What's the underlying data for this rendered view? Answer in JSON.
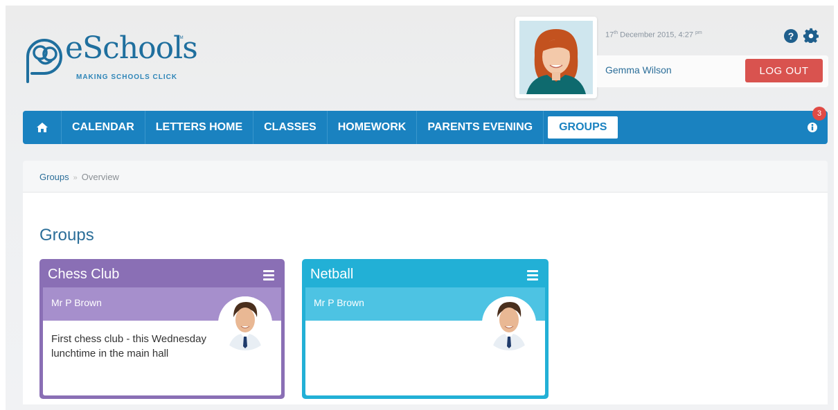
{
  "logo": {
    "wordmark": "eSchools",
    "tm": "TM",
    "tagline": "MAKING SCHOOLS CLICK"
  },
  "user": {
    "date_main": "17",
    "date_sup": "th",
    "date_rest": " December 2015, 4:27 ",
    "time_sup": "pm",
    "name": "Gemma Wilson",
    "logout_label": "LOG OUT"
  },
  "nav": {
    "items": [
      {
        "label": "CALENDAR"
      },
      {
        "label": "LETTERS HOME"
      },
      {
        "label": "CLASSES"
      },
      {
        "label": "HOMEWORK"
      },
      {
        "label": "PARENTS EVENING"
      },
      {
        "label": "GROUPS"
      }
    ],
    "notification_count": "3"
  },
  "breadcrumb": {
    "root": "Groups",
    "separator": "»",
    "current": "Overview"
  },
  "page": {
    "heading": "Groups"
  },
  "groups": [
    {
      "title": "Chess Club",
      "teacher": "Mr P Brown",
      "text": "First chess club - this Wednesday lunchtime in the main hall",
      "color": "#8a6fb5"
    },
    {
      "title": "Netball",
      "teacher": "Mr P Brown",
      "text": "",
      "color": "#22b0d6"
    }
  ],
  "colors": {
    "nav": "#1a82c0",
    "logout": "#d9534f",
    "badge": "#e04a45"
  }
}
